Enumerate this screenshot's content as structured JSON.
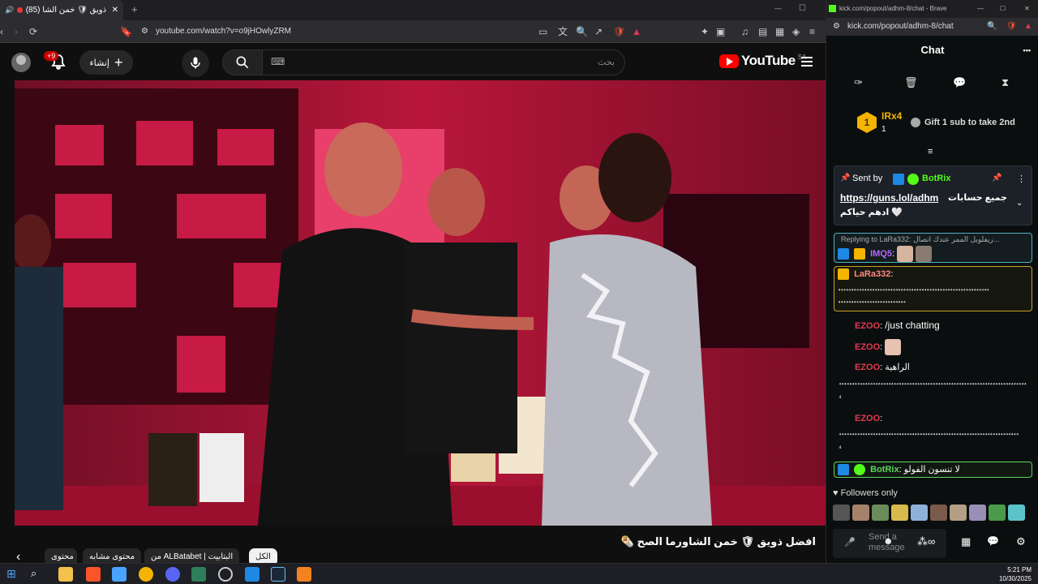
{
  "yt_browser": {
    "tab_title": "(85) افضل ذويق 🛡 خمن الشا...",
    "url": "youtube.com/watch?v=o9jHOwlyZRM",
    "new_tab": "+",
    "window_min": "—",
    "window_max": "☐",
    "window_close": "✕"
  },
  "youtube": {
    "logo_text": "YouTube",
    "country_code": "SA",
    "search_placeholder": "بحث",
    "create_label": "إنشاء",
    "notif_count": "+9"
  },
  "video_info": {
    "title": "افضل ذويق 🛡 خمن الشاورما الصح 🌯",
    "chips": [
      "الكل",
      "من ALBatabet | البتابيت",
      "محتوى مشابه",
      "محتوى"
    ]
  },
  "chat_browser": {
    "title": "kick.com/popout/adhm-8/chat - Brave",
    "url": "kick.com/popout/adhm-8/chat"
  },
  "chat": {
    "header": "Chat",
    "more": "•••",
    "leader_rank": "1",
    "leader_name": "IRx4",
    "leader_count": "1",
    "gift_text": "Gift 1 sub to take 2nd",
    "pinned_sent_by": "Sent by",
    "pinned_user": "BotRix",
    "pinned_link": "https://guns.lol/adhm",
    "pinned_text_ar": "جميع حسابات",
    "pinned_text2": "ادهم حياكم 🤍",
    "reply_text": "Replying to LaRa332: ريفلويل الممر عندك اتصال...",
    "messages": [
      {
        "user": "IMQ5",
        "text": "",
        "color": "#b26aff"
      },
      {
        "user": "LaRa332",
        "text": "⁴⁴⁴⁴⁴⁴⁴⁴⁴⁴⁴⁴⁴⁴⁴⁴⁴⁴⁴⁴⁴⁴⁴⁴⁴⁴⁴⁴⁴⁴⁴⁴⁴⁴⁴⁴⁴⁴⁴⁴⁴⁴⁴⁴⁴⁴⁴⁴⁴⁴⁴⁴⁴⁴⁴⁴⁴⁴",
        "color": "#ff8a80"
      },
      {
        "user": "EZOO",
        "text": "/just chatting",
        "color": "#e53950"
      },
      {
        "user": "EZOO",
        "text": "",
        "color": "#e53950"
      },
      {
        "user": "EZOO",
        "text": "الراهية",
        "color": "#e53950"
      },
      {
        "user": "",
        "text": "⁴⁴⁴⁴⁴⁴⁴⁴⁴⁴⁴⁴⁴⁴⁴⁴⁴⁴⁴⁴⁴⁴⁴⁴⁴⁴⁴⁴⁴⁴⁴⁴⁴⁴⁴⁴⁴⁴⁴⁴⁴⁴⁴⁴⁴⁴⁴⁴⁴⁴⁴⁴⁴⁴⁴⁴⁴⁴⁴⁴⁴⁴⁴⁴⁴⁴⁴⁴⁴⁴⁴⁴",
        "color": "#fff"
      },
      {
        "user": "EZOO",
        "text": "⁴⁴⁴⁴⁴⁴⁴⁴⁴⁴⁴⁴⁴⁴⁴⁴⁴⁴⁴⁴⁴⁴⁴⁴⁴⁴⁴⁴⁴⁴⁴⁴⁴⁴⁴⁴⁴⁴⁴⁴⁴⁴⁴⁴⁴⁴⁴⁴⁴⁴⁴⁴⁴⁴⁴⁴⁴⁴⁴⁴⁴⁴⁴⁴⁴⁴⁴⁴⁴",
        "color": "#e53950"
      },
      {
        "user": "BotRix",
        "text": "لا تنسون الفولو",
        "color": "#5bd65b"
      }
    ],
    "followers_only": "Followers only",
    "send_placeholder": "Send a message"
  },
  "taskbar": {
    "time": "5:21 PM",
    "date": "10/30/2025"
  },
  "colors": {
    "kick_green": "#53fc18",
    "yt_red": "#ff0000",
    "video_red": "#a80c2c"
  }
}
